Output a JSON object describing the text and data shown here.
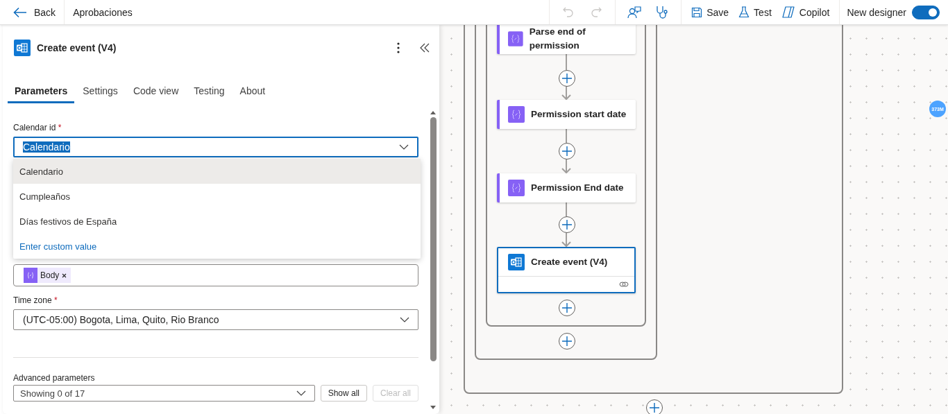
{
  "top_bar": {
    "back": "Back",
    "flow_name": "Aprobaciones",
    "history": [
      {
        "kind": "undo",
        "disabled": true
      },
      {
        "kind": "redo",
        "disabled": true
      }
    ],
    "actions": [
      {
        "kind": "save",
        "label": "Save"
      },
      {
        "kind": "test",
        "label": "Test"
      },
      {
        "kind": "copilot",
        "label": "Copilot"
      }
    ],
    "new_designer": {
      "label": "New designer",
      "on": true
    }
  },
  "panel": {
    "title": "Create event (V4)",
    "tabs": [
      {
        "label": "Parameters",
        "selected": true
      },
      {
        "label": "Settings",
        "selected": false
      },
      {
        "label": "Code view",
        "selected": false
      },
      {
        "label": "Testing",
        "selected": false
      },
      {
        "label": "About",
        "selected": false
      }
    ],
    "calendar_id": {
      "label": "Calendar id",
      "required_mark": "*",
      "value": "Calendario",
      "options": [
        {
          "label": "Calendario",
          "kind": "option",
          "selected": true
        },
        {
          "label": "Cumpleaños",
          "kind": "option",
          "selected": false
        },
        {
          "label": "Días festivos de España",
          "kind": "option",
          "selected": false
        },
        {
          "label": "Enter custom value",
          "kind": "custom",
          "selected": false
        }
      ]
    },
    "end_time": {
      "token": "Body"
    },
    "time_zone": {
      "label": "Time zone",
      "required_mark": "*",
      "value": "(UTC-05:00) Bogota, Lima, Quito, Rio Branco"
    },
    "advanced": {
      "label": "Advanced parameters",
      "value": "Showing 0 of 17",
      "show_all": "Show all",
      "clear_all": {
        "label": "Clear all",
        "disabled": true
      }
    }
  },
  "canvas": {
    "nodes": [
      {
        "title": "Parse end of permission",
        "kind": "variable",
        "selected": false
      },
      {
        "title": "Permission start date",
        "kind": "variable",
        "selected": false
      },
      {
        "title": "Permission End date",
        "kind": "variable",
        "selected": false
      },
      {
        "title": "Create event (V4)",
        "kind": "outlook",
        "selected": true
      }
    ],
    "badge": "373M"
  }
}
